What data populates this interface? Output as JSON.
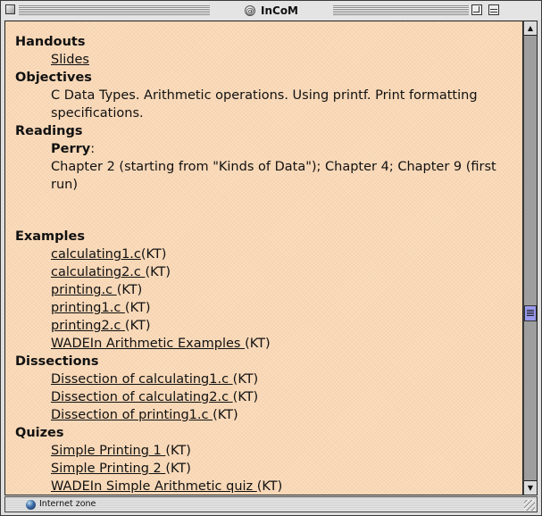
{
  "window": {
    "title": "InCoM",
    "title_icon": "at-sign-globe-icon"
  },
  "content": {
    "sections": {
      "handouts": {
        "heading": "Handouts",
        "items": [
          {
            "link": "Slides",
            "suffix": ""
          }
        ]
      },
      "objectives": {
        "heading": "Objectives",
        "text": "C Data Types. Arithmetic operations. Using printf. Print formatting specifications."
      },
      "readings": {
        "heading": "Readings",
        "author": "Perry",
        "author_suffix": ":",
        "text": "Chapter 2 (starting from \"Kinds of Data\"); Chapter 4; Chapter 9 (first run)"
      },
      "examples": {
        "heading": "Examples",
        "items": [
          {
            "link": "calculating1.c",
            "suffix": "(KT)"
          },
          {
            "link": "calculating2.c ",
            "suffix": "(KT)"
          },
          {
            "link": "printing.c ",
            "suffix": "(KT)"
          },
          {
            "link": "printing1.c ",
            "suffix": "(KT)"
          },
          {
            "link": "printing2.c ",
            "suffix": "(KT)"
          },
          {
            "link": "WADEIn Arithmetic Examples ",
            "suffix": "(KT)"
          }
        ]
      },
      "dissections": {
        "heading": "Dissections",
        "items": [
          {
            "link": "Dissection of calculating1.c ",
            "suffix": "(KT)"
          },
          {
            "link": "Dissection of calculating2.c ",
            "suffix": "(KT)"
          },
          {
            "link": "Dissection of printing1.c ",
            "suffix": "(KT)"
          }
        ]
      },
      "quizes": {
        "heading": "Quizes",
        "items": [
          {
            "link": "Simple Printing 1 ",
            "suffix": "(KT)"
          },
          {
            "link": "Simple Printing 2 ",
            "suffix": "(KT)"
          },
          {
            "link": "WADEIn Simple Arithmetic quiz ",
            "suffix": "(KT)"
          }
        ]
      }
    }
  },
  "scrollbar": {
    "up_arrow": "▲",
    "down_arrow": "▼",
    "position_fraction": 0.63
  },
  "status": {
    "zone_icon": "globe-icon",
    "zone_text": "Internet zone"
  },
  "colors": {
    "page_background": "#f8d8b8",
    "scroll_thumb": "#9999ee"
  }
}
